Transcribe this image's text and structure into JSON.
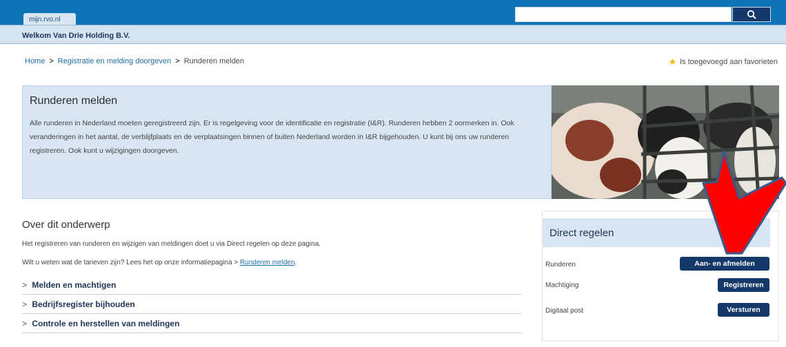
{
  "header": {
    "tab_label": "mijn.rvo.nl",
    "search_placeholder": "",
    "welcome": "Welkom Van Drie Holding B.V."
  },
  "breadcrumb": {
    "items": [
      "Home",
      "Registratie en melding doorgeven",
      "Runderen melden"
    ],
    "separator": ">",
    "favorite": "Is toegevoegd aan favorieten"
  },
  "intro": {
    "title": "Runderen melden",
    "body": "Alle runderen in Nederland moeten geregistreerd zijn. Er is regelgeving voor de identificatie en registratie (I&R). Runderen hebben 2 oormerken in. Ook veranderingen in het aantal, de verblijfplaats en de verplaatsingen binnen of buiten Nederland worden in I&R bijgehouden. U kunt bij ons uw runderen registreren. Ook kunt u wijzigingen doorgeven."
  },
  "section": {
    "title": "Over dit onderwerp",
    "p1": "Het registreren van runderen en wijzigen van meldingen doet u via Direct regelen op deze pagina.",
    "p2_prefix": "Wilt u weten wat de tarieven zijn? Lees het op onze informatiepagina",
    "p2_link": "Runderen melden",
    "accordion": [
      "Melden en machtigen",
      "Bedrijfsregister bijhouden",
      "Controle en herstellen van meldingen"
    ]
  },
  "direct": {
    "title": "Direct regelen",
    "rows": [
      {
        "label": "Runderen",
        "button": "Aan- en afmelden"
      },
      {
        "label": "Machtiging",
        "button": "Registreren"
      },
      {
        "label": "Digitaal post",
        "button": "Versturen"
      }
    ]
  },
  "colors": {
    "brand_blue": "#0f73b8",
    "dark_blue": "#15386a",
    "light_blue": "#d7e6f2",
    "annotation_red": "#ff0000"
  },
  "icons": [
    "search-icon",
    "star-icon",
    "chevron-right-icon",
    "red-arrow-annotation"
  ]
}
